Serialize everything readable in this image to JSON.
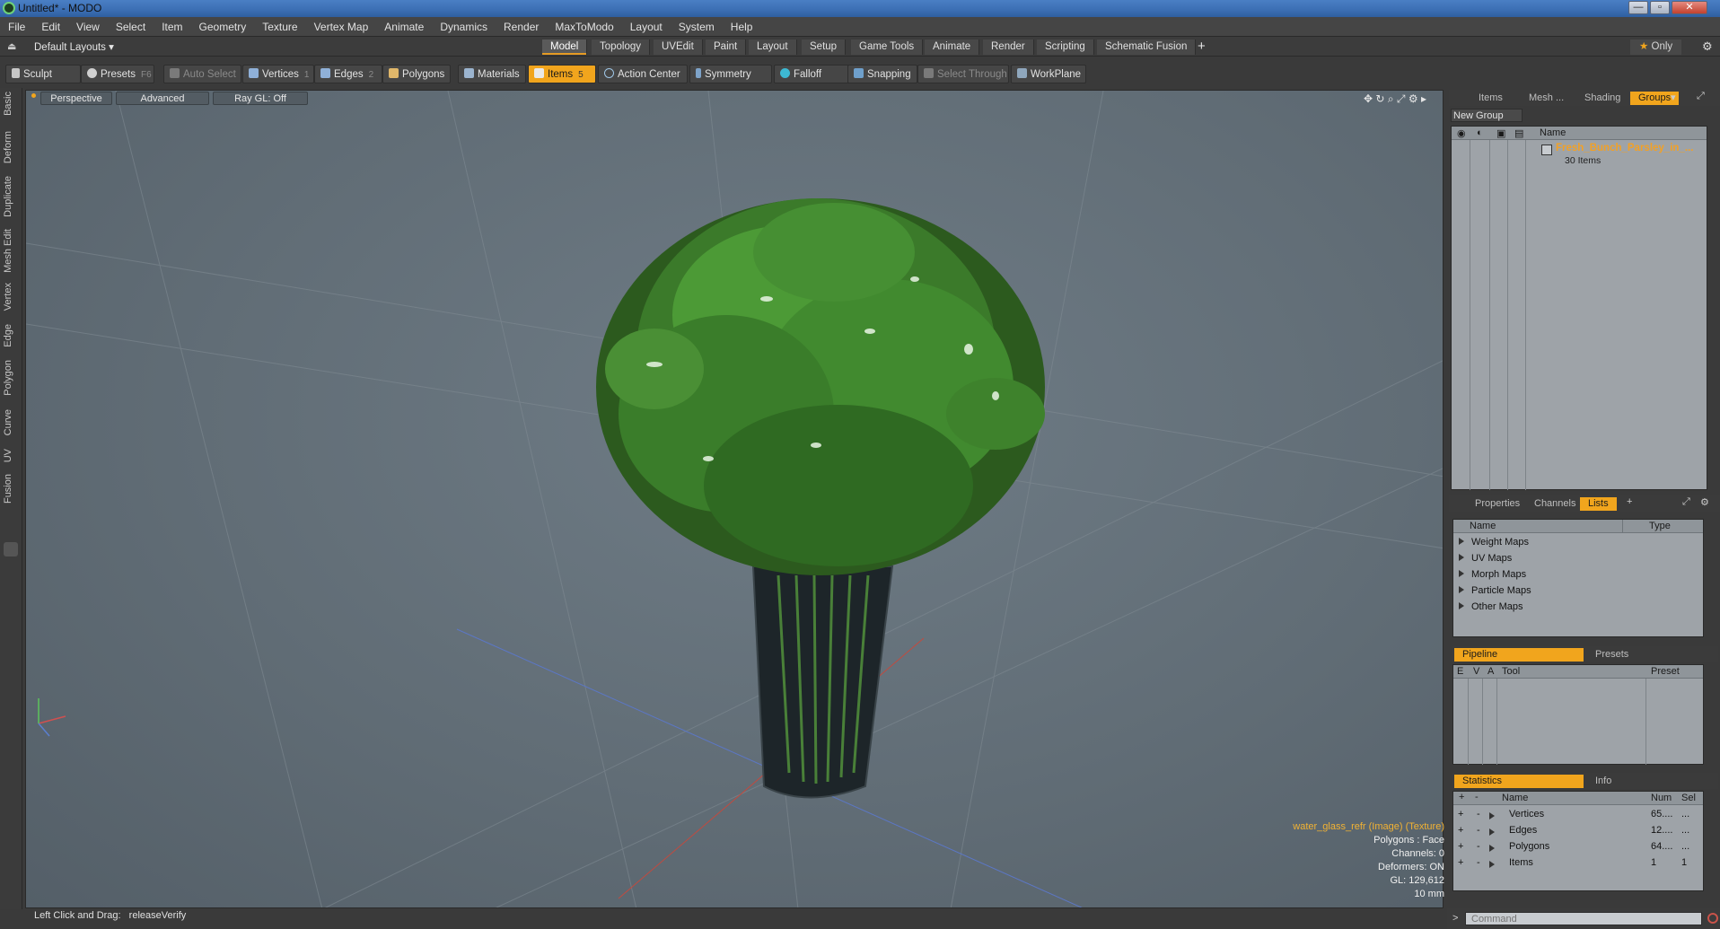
{
  "window": {
    "title": "Untitled* - MODO",
    "minimize": "—",
    "maximize": "▫",
    "close": "✕"
  },
  "menu": [
    "File",
    "Edit",
    "View",
    "Select",
    "Item",
    "Geometry",
    "Texture",
    "Vertex Map",
    "Animate",
    "Dynamics",
    "Render",
    "MaxToModo",
    "Layout",
    "System",
    "Help"
  ],
  "layout_bar": {
    "layout_name": "Default Layouts",
    "tabs": [
      "Model",
      "Topology",
      "UVEdit",
      "Paint",
      "Layout",
      "Setup",
      "Game Tools",
      "Animate",
      "Render",
      "Scripting",
      "Schematic Fusion"
    ],
    "active_tab": "Model",
    "add": "+",
    "only_label": "Only"
  },
  "toolbar": {
    "sculpt": "Sculpt",
    "presets": "Presets",
    "presets_key": "F6",
    "auto_select": "Auto Select",
    "vertices": "Vertices",
    "vertices_key": "1",
    "edges": "Edges",
    "edges_key": "2",
    "polygons": "Polygons",
    "materials": "Materials",
    "items": "Items",
    "items_key": "5",
    "action_center": "Action Center",
    "symmetry": "Symmetry",
    "falloff": "Falloff",
    "snapping": "Snapping",
    "select_through": "Select Through",
    "workplane": "WorkPlane"
  },
  "left_tabs": [
    "Basic",
    "Deform",
    "Duplicate",
    "Mesh Edit",
    "Vertex",
    "Edge",
    "Polygon",
    "Curve",
    "UV",
    "Fusion"
  ],
  "viewport": {
    "perspective": "Perspective",
    "advanced": "Advanced",
    "raygl": "Ray GL: Off",
    "info_title": "water_glass_refr (Image) (Texture)",
    "info_lines": [
      "Polygons : Face",
      "Channels: 0",
      "Deformers: ON",
      "GL: 129,612",
      "10 mm"
    ]
  },
  "status": {
    "hint": "Left Click and Drag:",
    "action": "releaseVerify"
  },
  "groups_panel": {
    "tabs": [
      "Items",
      "Mesh ...",
      "Shading",
      "Groups"
    ],
    "active_tab": "Groups",
    "new_group": "New Group",
    "name_col": "Name",
    "group_name": "Fresh_Bunch_Parsley_in_...",
    "group_count": "30 Items"
  },
  "lists_panel": {
    "tabs": [
      "Properties",
      "Channels",
      "Lists"
    ],
    "active_tab": "Lists",
    "add": "+",
    "name_col": "Name",
    "type_col": "Type",
    "items": [
      "Weight Maps",
      "UV Maps",
      "Morph Maps",
      "Particle Maps",
      "Other Maps"
    ]
  },
  "pipeline_panel": {
    "tabs": [
      "Pipeline",
      "Presets"
    ],
    "active_tab": "Pipeline",
    "cols": [
      "E",
      "V",
      "A",
      "Tool",
      "Preset"
    ]
  },
  "stats_panel": {
    "tabs": [
      "Statistics",
      "Info"
    ],
    "active_tab": "Statistics",
    "cols": [
      "+",
      "-",
      "Name",
      "Num",
      "Sel"
    ],
    "rows": [
      {
        "name": "Vertices",
        "num": "65....",
        "sel": "..."
      },
      {
        "name": "Edges",
        "num": "12....",
        "sel": "..."
      },
      {
        "name": "Polygons",
        "num": "64....",
        "sel": "..."
      },
      {
        "name": "Items",
        "num": "1",
        "sel": "1"
      }
    ]
  },
  "command": {
    "placeholder": "Command",
    "prompt": ">"
  },
  "colors": {
    "accent": "#f1a51d",
    "group_name": "#f2a126",
    "viewport_bg": "#616d76",
    "panel_bg": "#9ea3a8"
  }
}
